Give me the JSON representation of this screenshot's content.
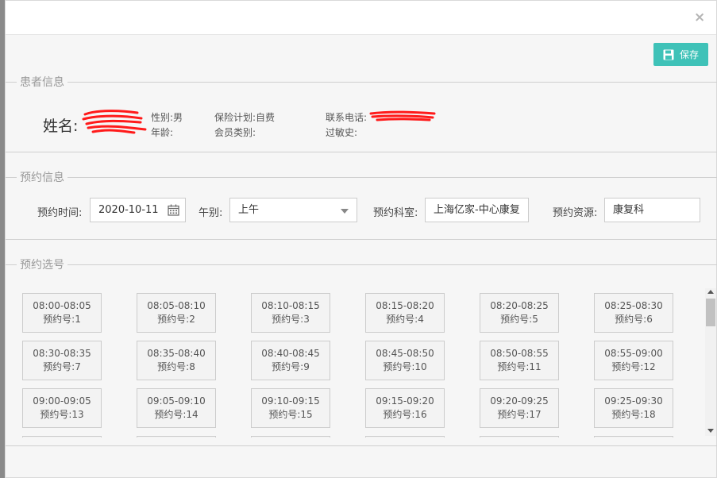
{
  "header": {
    "close_glyph": "×"
  },
  "toolbar": {
    "save_label": "保存"
  },
  "patient": {
    "legend": "患者信息",
    "name_label": "姓名:",
    "gender": "性别:男",
    "age": "年龄:",
    "insurance": "保险计划:自费",
    "member_type": "会员类别:",
    "phone_label": "联系电话:",
    "allergy": "过敏史:"
  },
  "appointment": {
    "legend": "预约信息",
    "time_label": "预约时间:",
    "time_value": "2020-10-11",
    "period_label": "午别:",
    "period_value": "上午",
    "dept_label": "预约科室:",
    "dept_value": "上海亿家-中心康复",
    "resource_label": "预约资源:",
    "resource_value": "康复科"
  },
  "slots": {
    "legend": "预约选号",
    "items": [
      {
        "time": "08:00-08:05",
        "no": "预约号:1"
      },
      {
        "time": "08:05-08:10",
        "no": "预约号:2"
      },
      {
        "time": "08:10-08:15",
        "no": "预约号:3"
      },
      {
        "time": "08:15-08:20",
        "no": "预约号:4"
      },
      {
        "time": "08:20-08:25",
        "no": "预约号:5"
      },
      {
        "time": "08:25-08:30",
        "no": "预约号:6"
      },
      {
        "time": "08:30-08:35",
        "no": "预约号:7"
      },
      {
        "time": "08:35-08:40",
        "no": "预约号:8"
      },
      {
        "time": "08:40-08:45",
        "no": "预约号:9"
      },
      {
        "time": "08:45-08:50",
        "no": "预约号:10"
      },
      {
        "time": "08:50-08:55",
        "no": "预约号:11"
      },
      {
        "time": "08:55-09:00",
        "no": "预约号:12"
      },
      {
        "time": "09:00-09:05",
        "no": "预约号:13"
      },
      {
        "time": "09:05-09:10",
        "no": "预约号:14"
      },
      {
        "time": "09:10-09:15",
        "no": "预约号:15"
      },
      {
        "time": "09:15-09:20",
        "no": "预约号:16"
      },
      {
        "time": "09:20-09:25",
        "no": "预约号:17"
      },
      {
        "time": "09:25-09:30",
        "no": "预约号:18"
      },
      {
        "time": "",
        "no": ""
      },
      {
        "time": "",
        "no": ""
      },
      {
        "time": "",
        "no": ""
      },
      {
        "time": "",
        "no": ""
      },
      {
        "time": "",
        "no": ""
      },
      {
        "time": "",
        "no": ""
      }
    ]
  },
  "colors": {
    "accent": "#3fc2b8",
    "redaction": "#ff0000"
  },
  "icons": {
    "save": "save-icon",
    "calendar": "calendar-icon",
    "close": "close-icon",
    "dropdown": "chevron-down-icon"
  }
}
